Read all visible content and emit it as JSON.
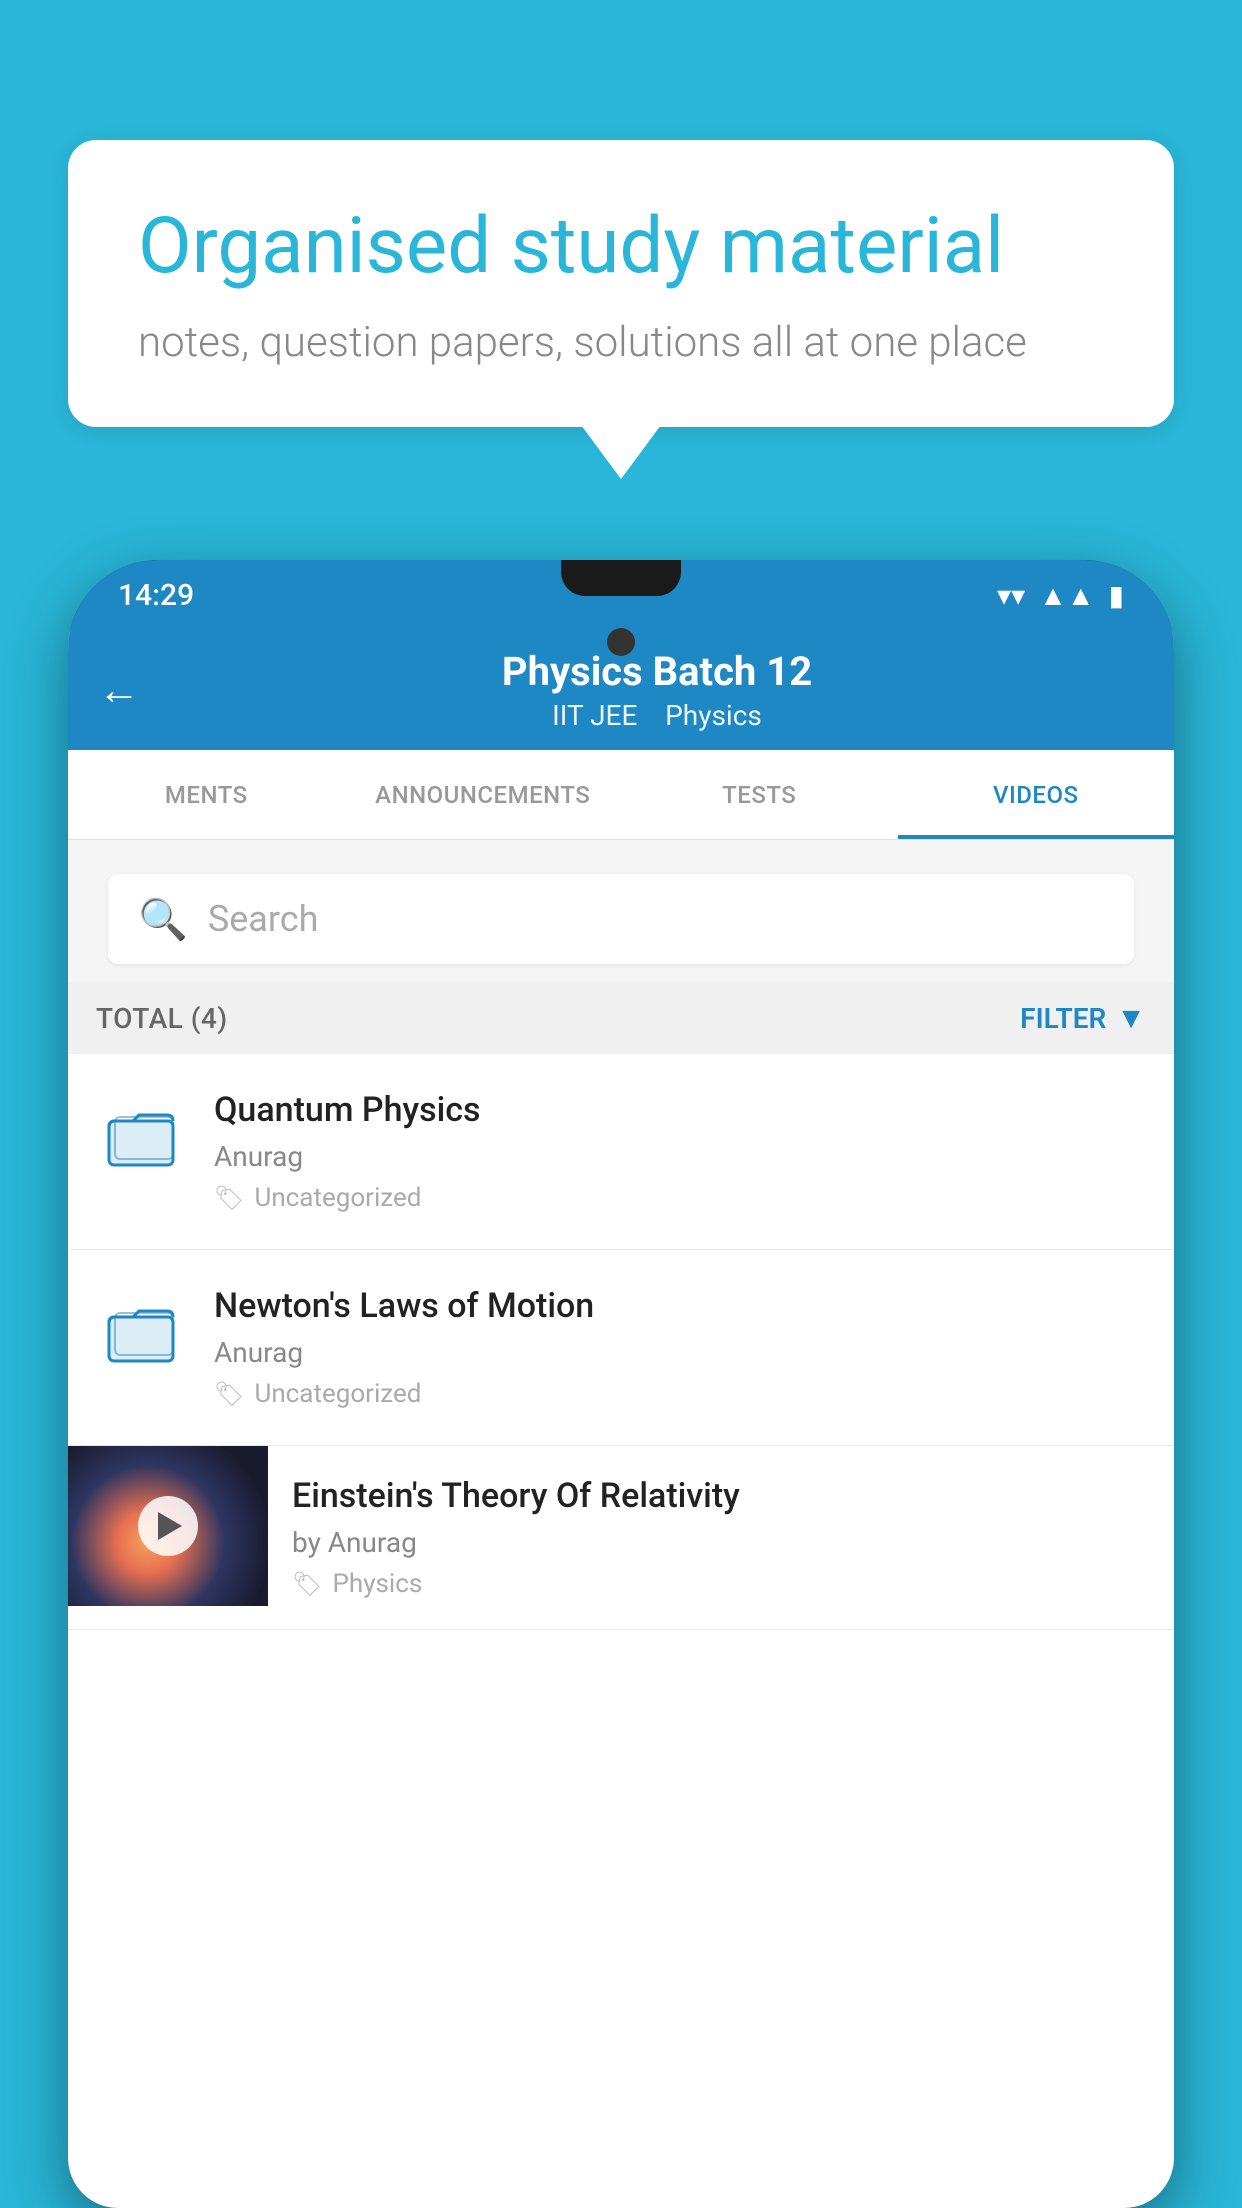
{
  "background_color": "#29B6D8",
  "speech_bubble": {
    "heading": "Organised study material",
    "subtext": "notes, question papers, solutions all at one place"
  },
  "phone": {
    "status_bar": {
      "time": "14:29",
      "icons": [
        "wifi",
        "signal",
        "battery"
      ]
    },
    "toolbar": {
      "back_label": "←",
      "title": "Physics Batch 12",
      "subtitle_parts": [
        "IIT JEE",
        "Physics"
      ]
    },
    "tabs": [
      {
        "label": "MENTS",
        "active": false
      },
      {
        "label": "ANNOUNCEMENTS",
        "active": false
      },
      {
        "label": "TESTS",
        "active": false
      },
      {
        "label": "VIDEOS",
        "active": true
      }
    ],
    "search": {
      "placeholder": "Search"
    },
    "filter_bar": {
      "total_label": "TOTAL (4)",
      "filter_label": "FILTER"
    },
    "list_items": [
      {
        "title": "Quantum Physics",
        "author": "Anurag",
        "tag": "Uncategorized",
        "type": "folder"
      },
      {
        "title": "Newton's Laws of Motion",
        "author": "Anurag",
        "tag": "Uncategorized",
        "type": "folder"
      },
      {
        "title": "Einstein's Theory Of Relativity",
        "author": "by Anurag",
        "tag": "Physics",
        "type": "video"
      }
    ]
  }
}
